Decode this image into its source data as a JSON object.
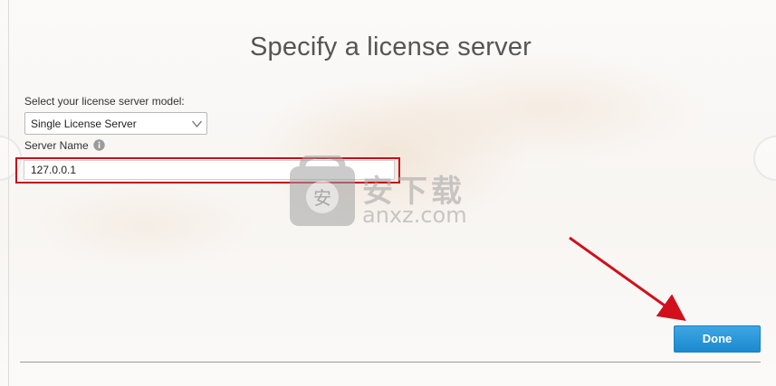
{
  "page": {
    "title": "Specify a license server"
  },
  "license_model": {
    "label": "Select your license server model:",
    "selected": "Single License Server",
    "icon": "chevron-down-icon"
  },
  "server_name": {
    "label": "Server Name",
    "info_icon": "info-icon",
    "value": "127.0.0.1",
    "highlight_color": "#c0121b"
  },
  "actions": {
    "done_label": "Done",
    "done_color": "#1b8ad0"
  },
  "watermark": {
    "cn": "安下载",
    "en": "anxz.com"
  },
  "annotation": {
    "arrow_color": "#d0101a"
  }
}
